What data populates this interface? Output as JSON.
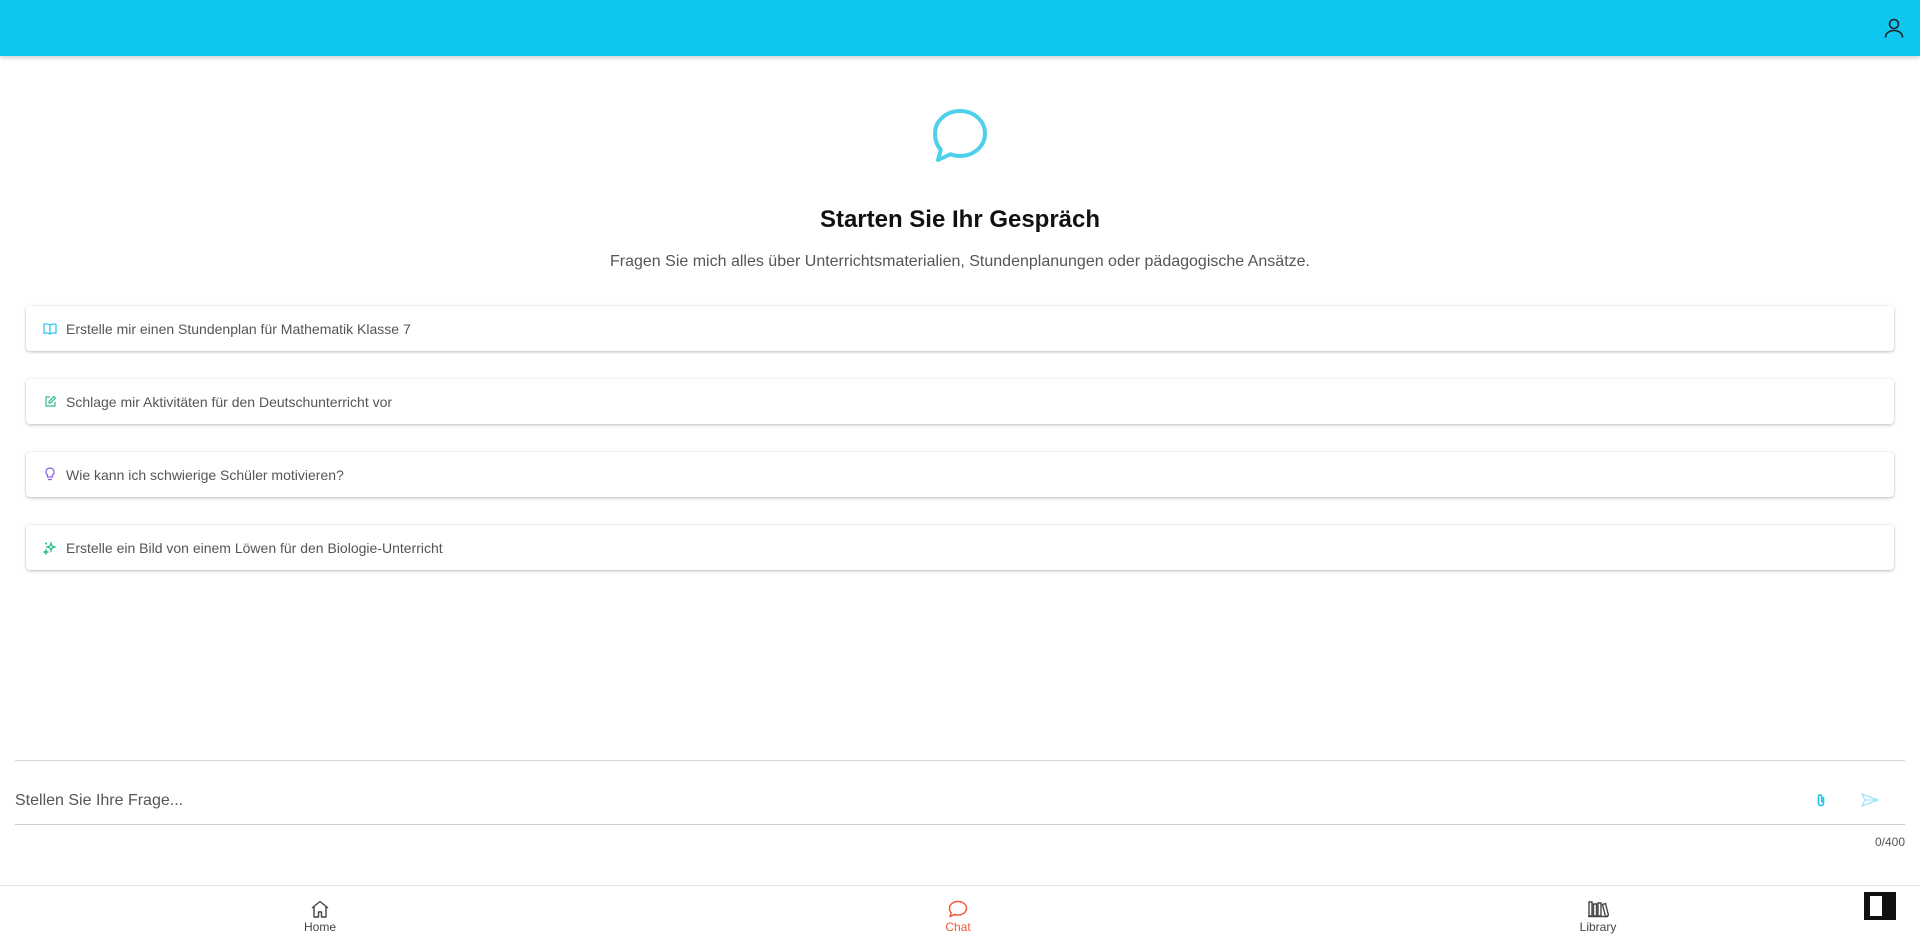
{
  "header": {
    "profile_icon": "person-icon",
    "color": "#0dc7ef"
  },
  "hero": {
    "icon": "chat-bubble-icon",
    "title": "Starten Sie Ihr Gespräch",
    "subtitle": "Fragen Sie mich alles über Unterrichtsmaterialien, Stundenplanungen oder pädagogische Ansätze."
  },
  "suggestions": [
    {
      "icon": "book-open-icon",
      "text": "Erstelle mir einen Stundenplan für Mathematik Klasse 7",
      "color": "#1cc6e6"
    },
    {
      "icon": "edit-square-icon",
      "text": "Schlage mir Aktivitäten für den Deutschunterricht vor",
      "color": "#2bbf87"
    },
    {
      "icon": "lightbulb-icon",
      "text": "Wie kann ich schwierige Schüler motivieren?",
      "color": "#8a63e8"
    },
    {
      "icon": "sparkle-icon",
      "text": "Erstelle ein Bild von einem Löwen für den Biologie-Unterricht",
      "color": "#2bbf87"
    }
  ],
  "composer": {
    "placeholder": "Stellen Sie Ihre Frage...",
    "value": "",
    "counter": "0/400",
    "attach_icon": "paperclip-icon",
    "send_icon": "send-icon"
  },
  "nav": {
    "items": [
      {
        "label": "Home",
        "icon": "home-icon",
        "active": false
      },
      {
        "label": "Chat",
        "icon": "chat-icon",
        "active": true
      },
      {
        "label": "Library",
        "icon": "library-icon",
        "active": false
      }
    ],
    "active_color": "#f15a3a"
  }
}
